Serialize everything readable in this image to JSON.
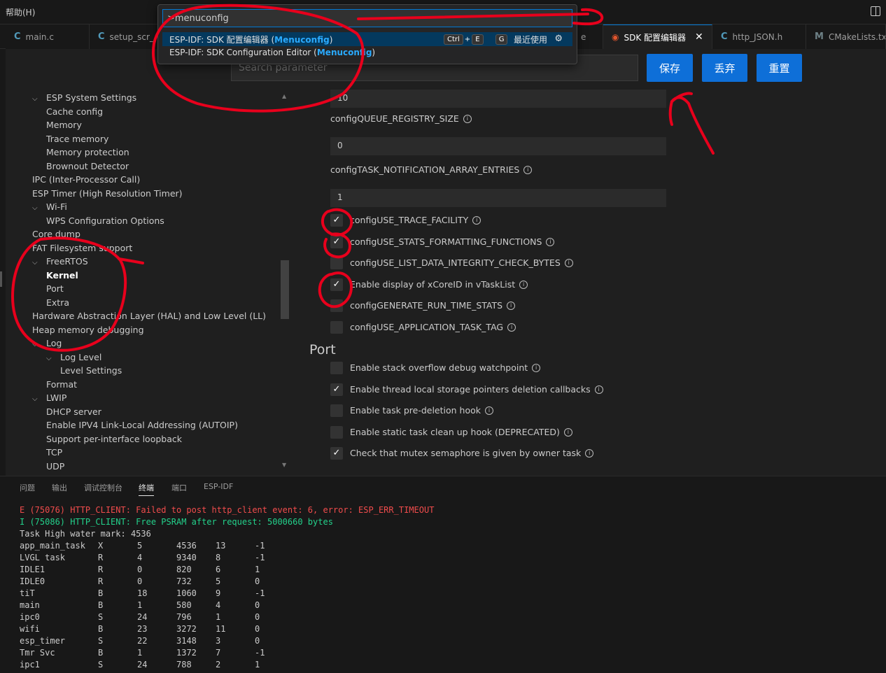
{
  "menu": {
    "help": "帮助(H)"
  },
  "tabs": [
    {
      "label": "main.c",
      "icon": "C"
    },
    {
      "label": "setup_scr_",
      "icon": "C"
    },
    {
      "label": "e",
      "icon": ""
    },
    {
      "label": "SDK 配置编辑器",
      "icon": "sdk-icon",
      "active": true
    },
    {
      "label": "http_JSON.h",
      "icon": "C"
    },
    {
      "label": "CMakeLists.txt",
      "icon": "M"
    }
  ],
  "palette": {
    "query": ">menuconfig",
    "results": [
      {
        "prefix": "ESP-IDF: SDK 配置编辑器 (",
        "highlight": "Menuconfig",
        "suffix": ")",
        "shortcut": [
          "Ctrl",
          "+",
          "E",
          "G"
        ],
        "recent": "最近使用"
      },
      {
        "prefix": "ESP-IDF: SDK Configuration Editor (",
        "highlight": "Menuconfig",
        "suffix": ")"
      }
    ]
  },
  "toolbar": {
    "search_placeholder": "Search parameter",
    "save": "保存",
    "discard": "丢弃",
    "reset": "重置"
  },
  "tree": [
    {
      "label": "ESP System Settings",
      "expanded": true
    },
    {
      "label": "Cache config"
    },
    {
      "label": "Memory"
    },
    {
      "label": "Trace memory"
    },
    {
      "label": "Memory protection"
    },
    {
      "label": "Brownout Detector"
    },
    {
      "label": "IPC (Inter-Processor Call)"
    },
    {
      "label": "ESP Timer (High Resolution Timer)"
    },
    {
      "label": "Wi-Fi",
      "expanded": true
    },
    {
      "label": "WPS Configuration Options"
    },
    {
      "label": "Core dump"
    },
    {
      "label": "FAT Filesystem support"
    },
    {
      "label": "FreeRTOS",
      "expanded": true
    },
    {
      "label": "Kernel",
      "selected": true
    },
    {
      "label": "Port"
    },
    {
      "label": "Extra"
    },
    {
      "label": "Hardware Abstraction Layer (HAL) and Low Level (LL)"
    },
    {
      "label": "Heap memory debugging"
    },
    {
      "label": "Log",
      "expanded": true
    },
    {
      "label": "Log Level",
      "expanded": true
    },
    {
      "label": "Level Settings"
    },
    {
      "label": "Format"
    },
    {
      "label": "LWIP",
      "expanded": true
    },
    {
      "label": "DHCP server"
    },
    {
      "label": "Enable IPV4 Link-Local Addressing (AUTOIP)"
    },
    {
      "label": "Support per-interface loopback"
    },
    {
      "label": "TCP"
    },
    {
      "label": "UDP"
    }
  ],
  "config": {
    "inputs": [
      {
        "value": "10",
        "label": "configQUEUE_REGISTRY_SIZE"
      },
      {
        "value": "0",
        "label": "configTASK_NOTIFICATION_ARRAY_ENTRIES"
      },
      {
        "value": "1",
        "label": ""
      }
    ],
    "kernel_checks": [
      {
        "label": "configUSE_TRACE_FACILITY",
        "checked": true
      },
      {
        "label": "configUSE_STATS_FORMATTING_FUNCTIONS",
        "checked": true
      },
      {
        "label": "configUSE_LIST_DATA_INTEGRITY_CHECK_BYTES",
        "checked": false
      },
      {
        "label": "Enable display of xCoreID in vTaskList",
        "checked": true
      },
      {
        "label": "configGENERATE_RUN_TIME_STATS",
        "checked": false
      },
      {
        "label": "configUSE_APPLICATION_TASK_TAG",
        "checked": false
      }
    ],
    "port_title": "Port",
    "port_checks": [
      {
        "label": "Enable stack overflow debug watchpoint",
        "checked": false
      },
      {
        "label": "Enable thread local storage pointers deletion callbacks",
        "checked": true
      },
      {
        "label": "Enable task pre-deletion hook",
        "checked": false
      },
      {
        "label": "Enable static task clean up hook (DEPRECATED)",
        "checked": false
      },
      {
        "label": "Check that mutex semaphore is given by owner task",
        "checked": true
      }
    ],
    "check_mark": "✓",
    "info_mark": "i"
  },
  "panel": {
    "tabs": [
      "问题",
      "输出",
      "调试控制台",
      "终端",
      "端口",
      "ESP-IDF"
    ],
    "active_tab": "终端"
  },
  "terminal": {
    "lines": [
      "E (75076) HTTP_CLIENT: Failed to post http_client event: 6, error: ESP_ERR_TIMEOUT",
      "I (75086) HTTP_CLIENT: Free PSRAM after request: 5000660 bytes",
      "Task High water mark: 4536"
    ],
    "tasks": [
      [
        "app_main_task",
        "X",
        "5",
        "4536",
        "13",
        "-1"
      ],
      [
        "LVGL task",
        "R",
        "4",
        "9340",
        "8",
        "-1"
      ],
      [
        "IDLE1",
        "R",
        "0",
        "820",
        "6",
        "1"
      ],
      [
        "IDLE0",
        "R",
        "0",
        "732",
        "5",
        "0"
      ],
      [
        "tiT",
        "B",
        "18",
        "1060",
        "9",
        "-1"
      ],
      [
        "main",
        "B",
        "1",
        "580",
        "4",
        "0"
      ],
      [
        "ipc0",
        "S",
        "24",
        "796",
        "1",
        "0"
      ],
      [
        "wifi",
        "B",
        "23",
        "3272",
        "11",
        "0"
      ],
      [
        "esp_timer",
        "S",
        "22",
        "3148",
        "3",
        "0"
      ],
      [
        "Tmr Svc",
        "B",
        "1",
        "1372",
        "7",
        "-1"
      ],
      [
        "ipc1",
        "S",
        "24",
        "788",
        "2",
        "1"
      ]
    ]
  },
  "colors": {
    "accent": "#0e6fd8",
    "annotation": "#e8001c",
    "error": "#f14c4c",
    "success": "#23d18b"
  }
}
